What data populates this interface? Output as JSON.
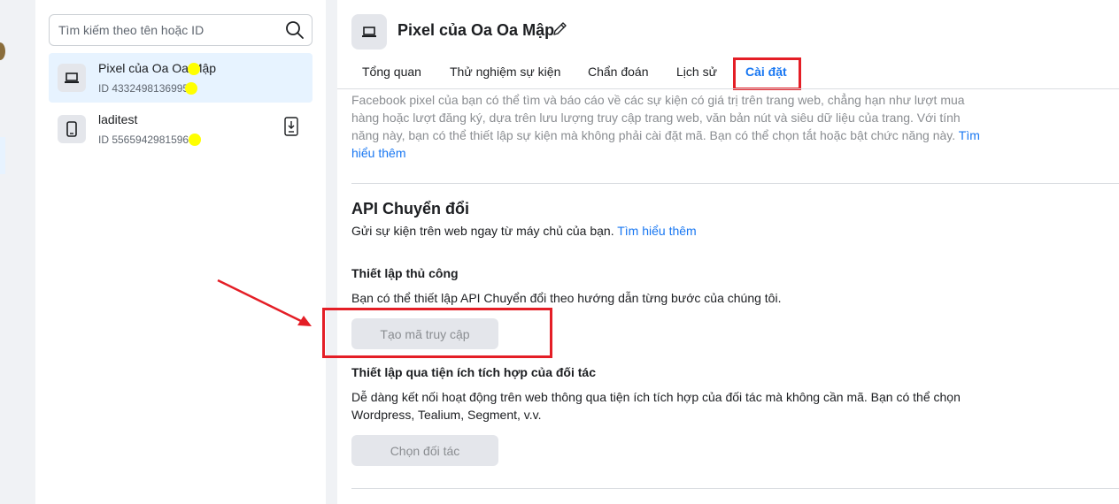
{
  "search": {
    "placeholder": "Tìm kiếm theo tên hoặc ID"
  },
  "pixels": [
    {
      "name": "Pixel của Oa Oa Mập",
      "id_label": "ID 43324981369952",
      "selected": true,
      "icon": "laptop-icon"
    },
    {
      "name": "laditest",
      "id_label": "ID 5565942981596",
      "selected": false,
      "icon": "phone-icon"
    }
  ],
  "header": {
    "title": "Pixel của Oa Oa Mập",
    "icon": "laptop-icon",
    "edit_icon": "pencil-icon"
  },
  "tabs": [
    {
      "label": "Tổng quan"
    },
    {
      "label": "Thử nghiệm sự kiện"
    },
    {
      "label": "Chẩn đoán"
    },
    {
      "label": "Lịch sử"
    },
    {
      "label": "Cài đặt",
      "active": true
    }
  ],
  "settings": {
    "intro": "Facebook pixel của bạn có thể tìm và báo cáo về các sự kiện có giá trị trên trang web, chẳng hạn như lượt mua hàng hoặc lượt đăng ký, dựa trên lưu lượng truy cập trang web, văn bản nút và siêu dữ liệu của trang. Với tính năng này, bạn có thể thiết lập sự kiện mà không phải cài đặt mã. Bạn có thể chọn tắt hoặc bật chức năng này.",
    "intro_link": "Tìm hiểu thêm",
    "api": {
      "title": "API Chuyển đổi",
      "description": "Gửi sự kiện trên web ngay từ máy chủ của bạn.",
      "link": "Tìm hiểu thêm",
      "manual_title": "Thiết lập thủ công",
      "manual_description": "Bạn có thể thiết lập API Chuyển đổi theo hướng dẫn từng bước của chúng tôi.",
      "manual_button": "Tạo mã truy cập",
      "partner_title": "Thiết lập qua tiện ích tích hợp của đối tác",
      "partner_description": "Dễ dàng kết nối hoạt động trên web thông qua tiện ích tích hợp của đối tác mà không cần mã. Bạn có thể chọn Wordpress, Tealium, Segment, v.v.",
      "partner_button": "Chọn đối tác"
    }
  },
  "colors": {
    "accent": "#1877f2",
    "annotation": "#e41e26",
    "redaction": "#ffff00"
  }
}
